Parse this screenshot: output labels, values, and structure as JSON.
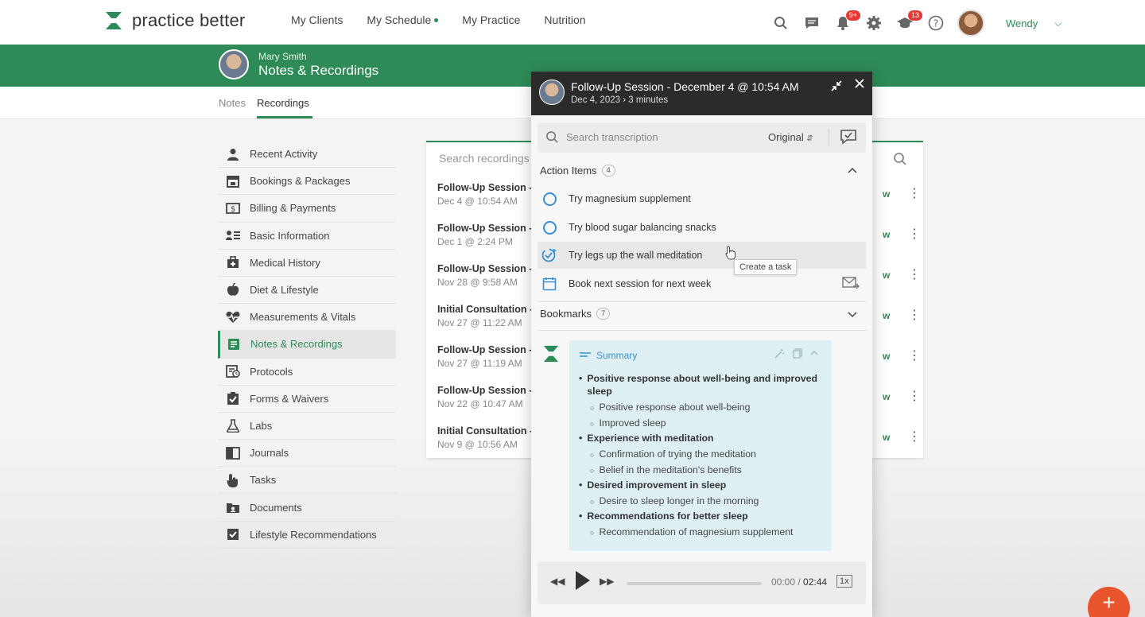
{
  "brand": {
    "name": "practice better"
  },
  "nav": {
    "items": [
      {
        "label": "My Clients"
      },
      {
        "label": "My Schedule"
      },
      {
        "label": "My Practice"
      },
      {
        "label": "Nutrition"
      }
    ]
  },
  "top_icons": {
    "notifications_badge": "9+",
    "updates_badge": "13"
  },
  "user": {
    "name": "Wendy"
  },
  "client": {
    "name": "Mary Smith",
    "page_title": "Notes & Recordings"
  },
  "subtabs": [
    "Notes",
    "Recordings"
  ],
  "sidebar": {
    "items": [
      {
        "label": "Recent Activity",
        "icon": "person-icon"
      },
      {
        "label": "Bookings & Packages",
        "icon": "calendar-icon"
      },
      {
        "label": "Billing & Payments",
        "icon": "dollar-icon"
      },
      {
        "label": "Basic Information",
        "icon": "person-list-icon"
      },
      {
        "label": "Medical History",
        "icon": "medical-kit-icon"
      },
      {
        "label": "Diet & Lifestyle",
        "icon": "apple-icon"
      },
      {
        "label": "Measurements & Vitals",
        "icon": "heart-pulse-icon"
      },
      {
        "label": "Notes & Recordings",
        "icon": "notes-icon",
        "active": true
      },
      {
        "label": "Protocols",
        "icon": "protocol-icon"
      },
      {
        "label": "Forms & Waivers",
        "icon": "checklist-icon"
      },
      {
        "label": "Labs",
        "icon": "flask-icon"
      },
      {
        "label": "Journals",
        "icon": "journal-icon"
      },
      {
        "label": "Tasks",
        "icon": "hand-icon"
      },
      {
        "label": "Documents",
        "icon": "folder-icon"
      },
      {
        "label": "Lifestyle Recommendations",
        "icon": "checkbox-icon"
      }
    ]
  },
  "recordings": {
    "search_placeholder": "Search recordings",
    "rows": [
      {
        "title": "Follow-Up Session -",
        "date": "Dec 4 @ 10:54 AM"
      },
      {
        "title": "Follow-Up Session -",
        "date": "Dec 1 @ 2:24 PM"
      },
      {
        "title": "Follow-Up Session -",
        "date": "Nov 28 @ 9:58 AM"
      },
      {
        "title": "Initial Consultation -",
        "date": "Nov 27 @ 11:22 AM"
      },
      {
        "title": "Follow-Up Session -",
        "date": "Nov 27 @ 11:19 AM"
      },
      {
        "title": "Follow-Up Session -",
        "date": "Nov 22 @ 10:47 AM"
      },
      {
        "title": "Initial Consultation -",
        "date": "Nov 9 @ 10:56 AM"
      }
    ],
    "row_action": "w"
  },
  "modal": {
    "title": "Follow-Up Session - December 4 @ 10:54 AM",
    "subtitle": "Dec 4, 2023 › 3 minutes",
    "search_placeholder": "Search transcription",
    "transcript_mode": "Original",
    "action_items": {
      "label": "Action Items",
      "count": "4",
      "items": [
        {
          "text": "Try magnesium supplement",
          "state": "open"
        },
        {
          "text": "Try blood sugar balancing snacks",
          "state": "open"
        },
        {
          "text": "Try legs up the wall meditation",
          "state": "add-task"
        },
        {
          "text": "Book next session for next week",
          "state": "booking"
        }
      ],
      "tooltip": "Create a task"
    },
    "bookmarks": {
      "label": "Bookmarks",
      "count": "7"
    },
    "summary": {
      "label": "Summary",
      "points": [
        {
          "text": "Positive response about well-being and improved sleep",
          "subs": [
            "Positive response about well-being",
            "Improved sleep"
          ]
        },
        {
          "text": "Experience with meditation",
          "subs": [
            "Confirmation of trying the meditation",
            "Belief in the meditation's benefits"
          ]
        },
        {
          "text": "Desired improvement in sleep",
          "subs": [
            "Desire to sleep longer in the morning"
          ]
        },
        {
          "text": "Recommendations for better sleep",
          "subs": [
            "Recommendation of magnesium supplement"
          ]
        }
      ]
    },
    "player": {
      "current": "00:00",
      "separator": " / ",
      "total": "02:44",
      "speed": "1x",
      "progress": 0
    }
  },
  "colors": {
    "brand_green": "#2e8b57",
    "accent_blue": "#3a8fd0",
    "fab_orange": "#e8542c"
  }
}
